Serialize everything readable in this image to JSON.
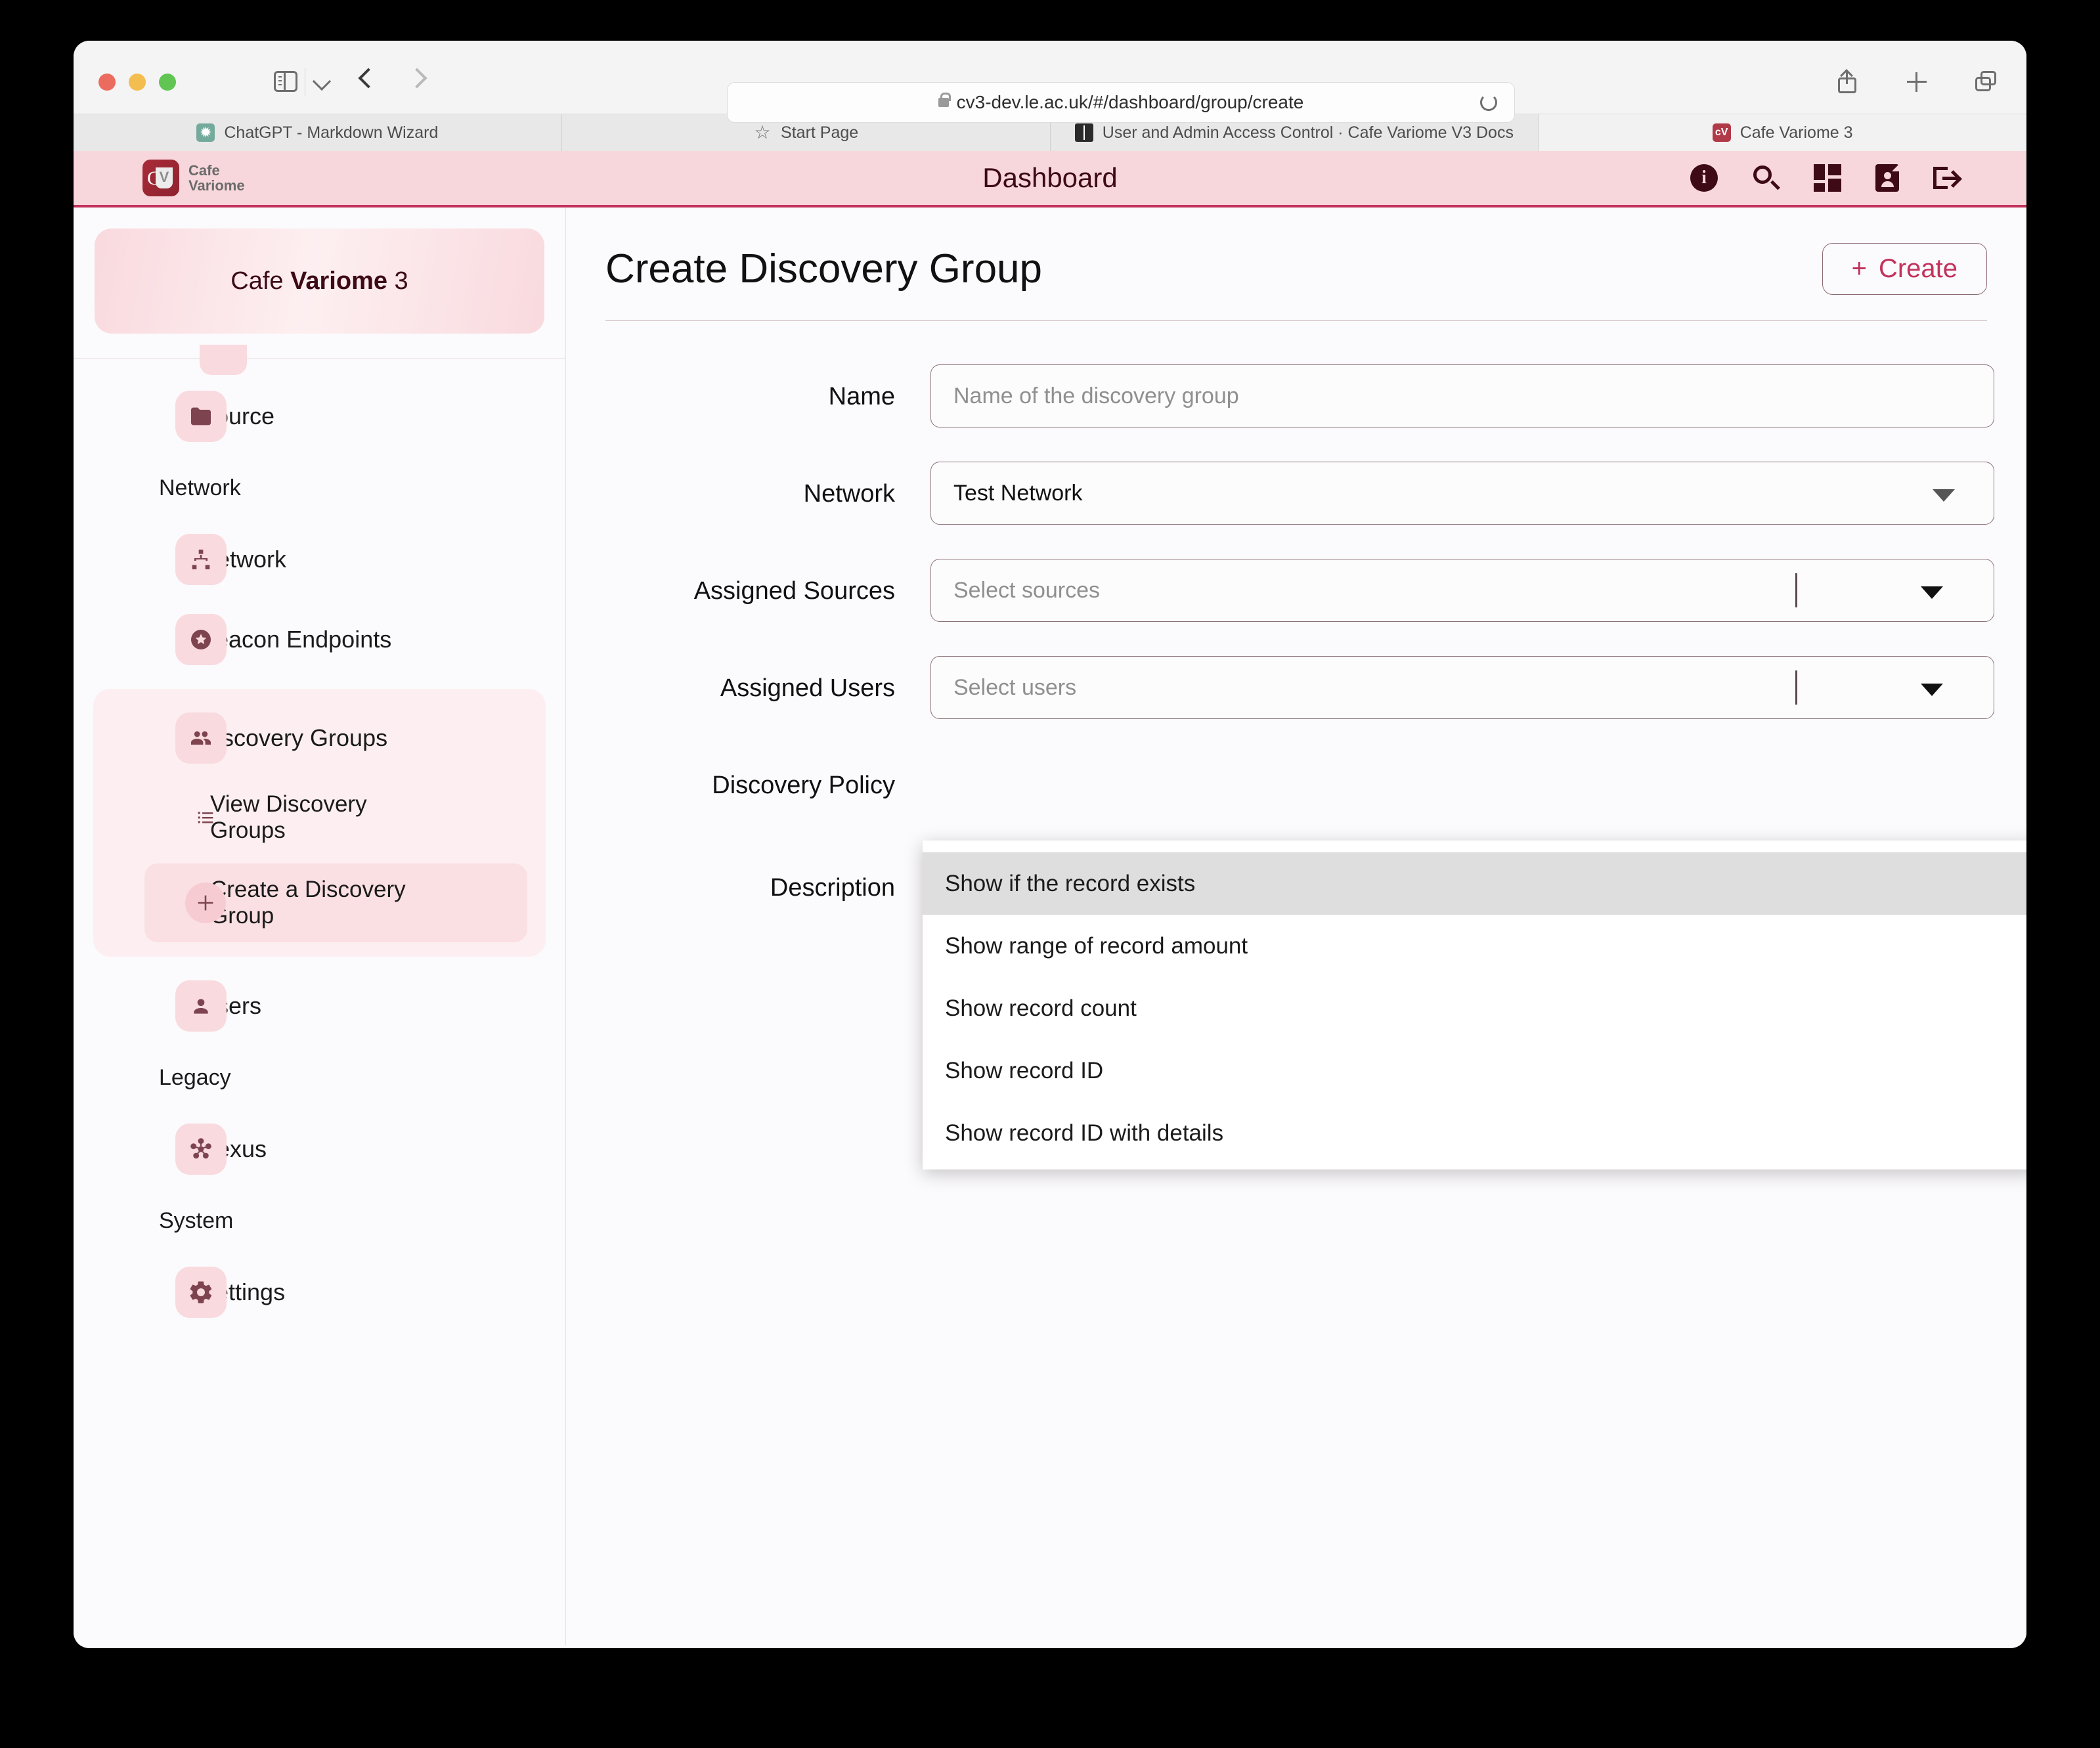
{
  "browser": {
    "url": "cv3-dev.le.ac.uk/#/dashboard/group/create",
    "nav_back_icon": "chevron-left-icon",
    "nav_forward_icon": "chevron-right-icon",
    "reload_icon": "reload-icon",
    "lock_icon": "lock-icon",
    "sidebar_toggle_icon": "sidebar-toggle-icon",
    "share_icon": "share-icon",
    "new_tab_icon": "plus-icon",
    "tab_overview_icon": "tab-overview-icon",
    "tabs": [
      {
        "label": "ChatGPT - Markdown Wizard",
        "favicon": "chatgpt-icon",
        "active": false
      },
      {
        "label": "Start Page",
        "favicon": "star-icon",
        "active": false
      },
      {
        "label": "User and Admin Access Control · Cafe Variome V3 Docs",
        "favicon": "book-icon",
        "active": false
      },
      {
        "label": "Cafe Variome 3",
        "favicon": "cafe-variome-icon",
        "active": true
      }
    ]
  },
  "app_header": {
    "logo_line1": "Cafe",
    "logo_line2": "Variome",
    "title": "Dashboard",
    "icons": [
      "info-icon",
      "search-icon",
      "grid-icon",
      "contact-card-icon",
      "logout-icon"
    ]
  },
  "sidebar": {
    "org_card": {
      "prefix": "Cafe ",
      "bold": "Variome",
      "suffix": " 3"
    },
    "items": [
      {
        "label": "Source",
        "icon": "folder-icon",
        "type": "item"
      },
      {
        "label": "Network",
        "type": "section"
      },
      {
        "label": "Network",
        "icon": "sitemap-icon",
        "type": "item"
      },
      {
        "label": "Beacon Endpoints",
        "icon": "star-circle-icon",
        "type": "item"
      }
    ],
    "discovery": {
      "parent": {
        "label": "Discovery Groups",
        "icon": "people-icon"
      },
      "children": [
        {
          "label": "View Discovery Groups",
          "icon": "list-icon",
          "selected": false
        },
        {
          "label": "Create a Discovery Group",
          "icon": "plus-icon",
          "selected": true
        }
      ]
    },
    "items_after": [
      {
        "label": "Users",
        "icon": "person-icon",
        "type": "item"
      },
      {
        "label": "Legacy",
        "type": "section"
      },
      {
        "label": "Nexus",
        "icon": "nexus-icon",
        "type": "item"
      },
      {
        "label": "System",
        "type": "section"
      },
      {
        "label": "Settings",
        "icon": "gear-icon",
        "type": "item"
      }
    ]
  },
  "main": {
    "page_title": "Create Discovery Group",
    "create_button": {
      "plus": "+",
      "label": "Create"
    },
    "form": {
      "name": {
        "label": "Name",
        "placeholder": "Name of the discovery group",
        "value": ""
      },
      "network": {
        "label": "Network",
        "value": "Test Network"
      },
      "assigned_sources": {
        "label": "Assigned Sources",
        "placeholder": "Select sources",
        "value": ""
      },
      "assigned_users": {
        "label": "Assigned Users",
        "placeholder": "Select users",
        "value": ""
      },
      "discovery_policy": {
        "label": "Discovery Policy"
      },
      "description": {
        "label": "Description"
      },
      "help_icon": "?"
    },
    "dropdown": {
      "options": [
        {
          "label": "Show if the record exists",
          "highlighted": true
        },
        {
          "label": "Show range of record amount",
          "highlighted": false
        },
        {
          "label": "Show record count",
          "highlighted": false
        },
        {
          "label": "Show record ID",
          "highlighted": false
        },
        {
          "label": "Show record ID with details",
          "highlighted": false
        }
      ]
    }
  },
  "colors": {
    "accent": "#c2325c",
    "header_bg": "#f8d7dc",
    "maroon": "#3d0a16",
    "icon_tile": "#f9dade"
  }
}
